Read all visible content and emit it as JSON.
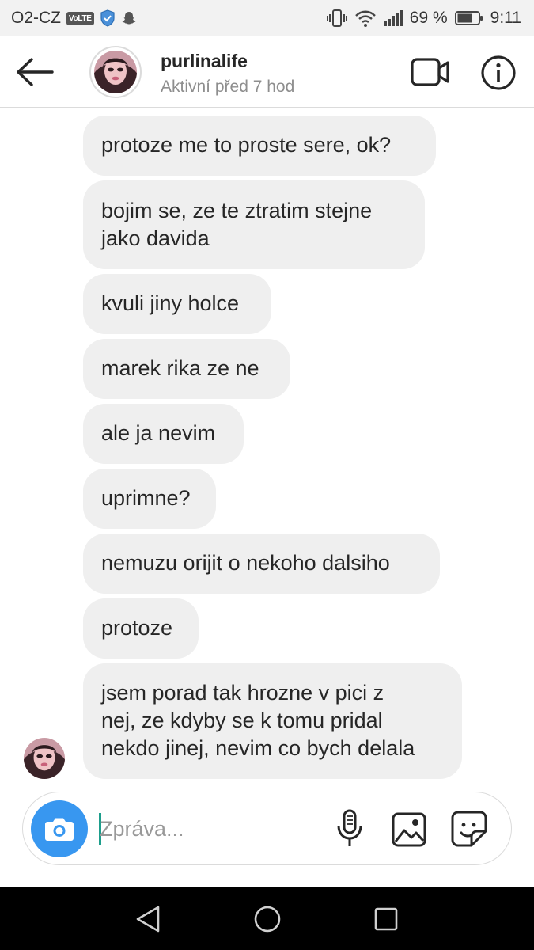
{
  "status_bar": {
    "carrier": "O2-CZ",
    "volte": "VoLTE",
    "battery": "69 %",
    "time": "9:11"
  },
  "header": {
    "username": "purlinalife",
    "status": "Aktivní před 7 hod"
  },
  "messages": [
    {
      "lines": [
        "protoze me to proste sere, ok?"
      ]
    },
    {
      "lines": [
        "bojim se, ze te ztratim stejne",
        "jako davida"
      ]
    },
    {
      "lines": [
        "kvuli jiny holce"
      ]
    },
    {
      "lines": [
        "marek rika ze ne"
      ]
    },
    {
      "lines": [
        "ale ja nevim"
      ]
    },
    {
      "lines": [
        "uprimne?"
      ]
    },
    {
      "lines": [
        "nemuzu orijit o nekoho dalsiho"
      ]
    },
    {
      "lines": [
        "protoze"
      ]
    },
    {
      "lines": [
        "jsem porad tak hrozne v pici z",
        "nej, ze kdyby se k tomu pridal",
        "nekdo jinej, nevim co bych delala"
      ]
    }
  ],
  "composer": {
    "placeholder": "Zpráva..."
  },
  "icons": {
    "back": "arrow-left-icon",
    "video": "video-camera-icon",
    "info": "info-icon",
    "camera": "camera-icon",
    "mic": "microphone-icon",
    "gallery": "image-icon",
    "sticker": "sticker-icon"
  },
  "colors": {
    "accent": "#3897f0",
    "bubble": "#efefef",
    "muted_text": "#8e8e8e",
    "navbar": "#000000"
  }
}
